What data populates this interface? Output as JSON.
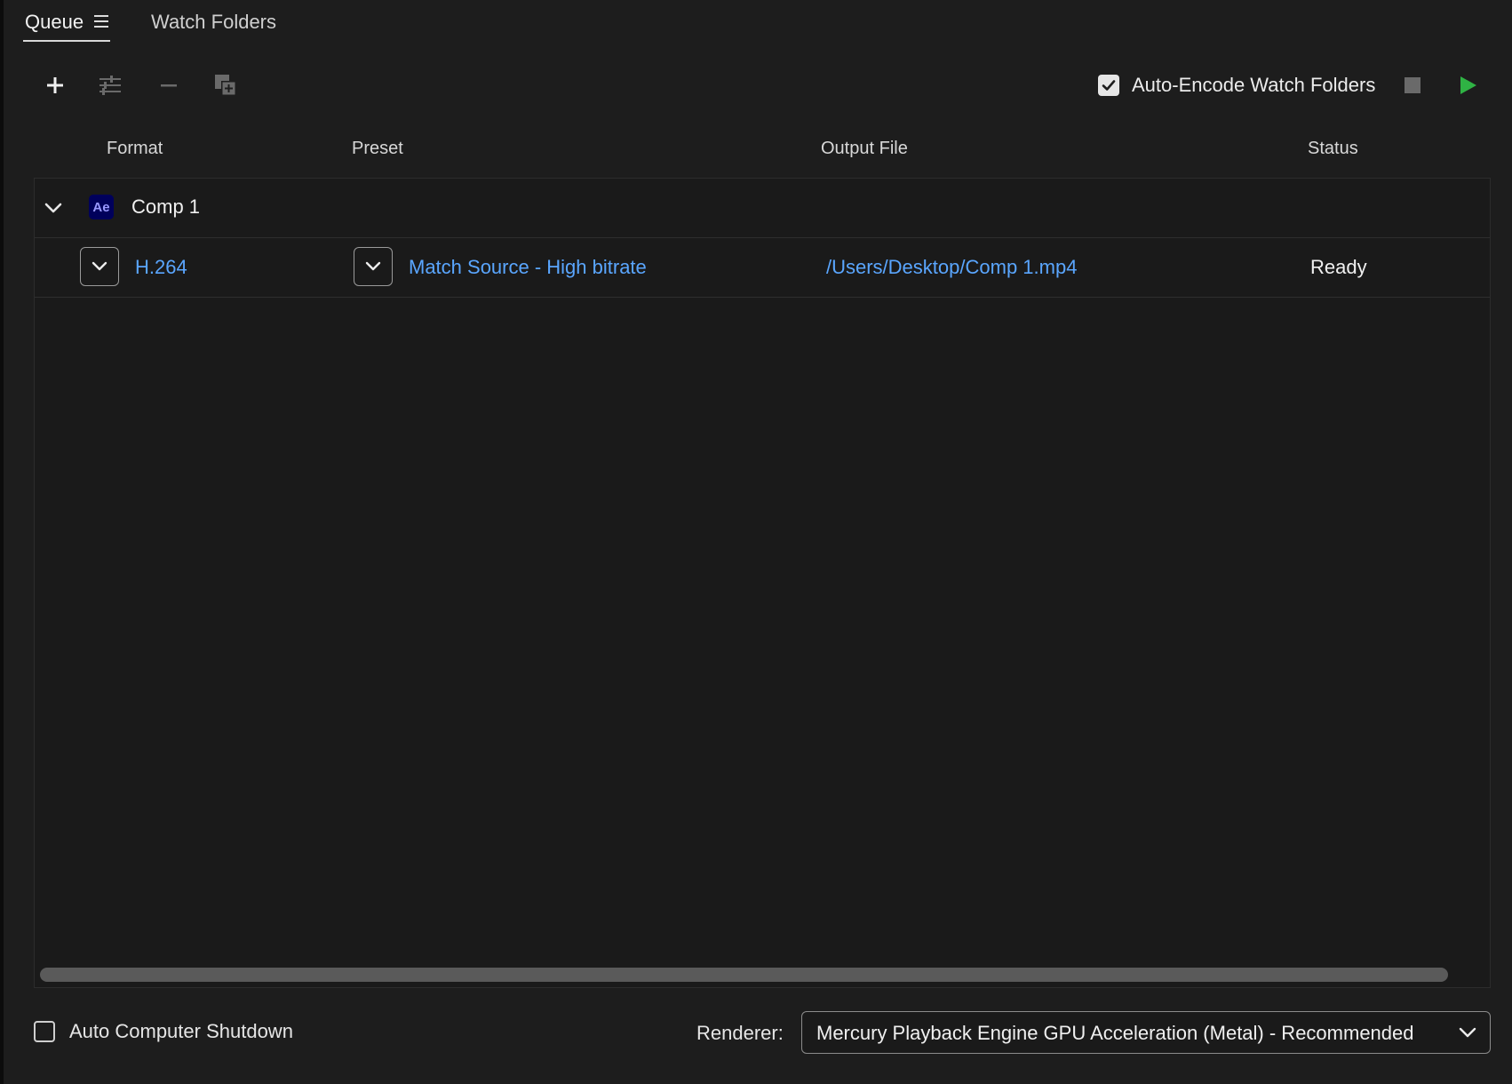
{
  "tabs": {
    "queue_label": "Queue",
    "watch_folders_label": "Watch Folders"
  },
  "toolbar": {
    "add_icon": "plus-icon",
    "settings_icon": "sliders-icon",
    "remove_icon": "minus-icon",
    "duplicate_icon": "duplicate-icon",
    "auto_encode_label": "Auto-Encode Watch Folders",
    "auto_encode_checked": true,
    "stop_icon": "stop-icon",
    "start_icon": "play-icon",
    "start_color": "#2fb344"
  },
  "columns": {
    "format": "Format",
    "preset": "Preset",
    "output_file": "Output File",
    "status": "Status"
  },
  "queue": {
    "group": {
      "app_badge": "Ae",
      "name": "Comp 1"
    },
    "item": {
      "format": "H.264",
      "preset": "Match Source - High bitrate",
      "output_file": "/Users/Desktop/Comp 1.mp4",
      "status": "Ready"
    }
  },
  "footer": {
    "auto_shutdown_label": "Auto Computer Shutdown",
    "auto_shutdown_checked": false,
    "renderer_label": "Renderer:",
    "renderer_value": "Mercury Playback Engine GPU Acceleration (Metal) - Recommended"
  },
  "colors": {
    "background": "#1d1d1d",
    "link": "#5aa6ff",
    "ae_badge_bg": "#00005b",
    "ae_badge_text": "#9999ff"
  }
}
